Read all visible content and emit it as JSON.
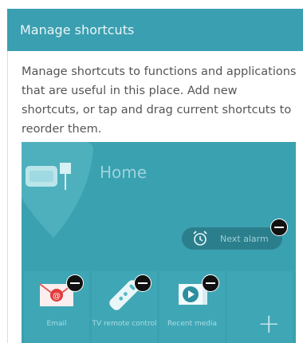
{
  "header": {
    "title": "Manage shortcuts"
  },
  "description": "Manage shortcuts to functions and applications that are useful in this place. Add new shortcuts, or tap and drag current shortcuts to reorder them.",
  "panel": {
    "place_label": "Home",
    "next_alarm_label": "Next alarm",
    "shortcuts": [
      {
        "label": "Email",
        "icon": "email-icon"
      },
      {
        "label": "TV remote control",
        "icon": "remote-control-icon"
      },
      {
        "label": "Recent media",
        "icon": "media-play-icon"
      }
    ],
    "add_icon": "plus-icon"
  },
  "colors": {
    "header": "#3a9fb0",
    "panel": "#3aa1b0",
    "pill": "#2b7f8c",
    "remove": "#111111"
  }
}
